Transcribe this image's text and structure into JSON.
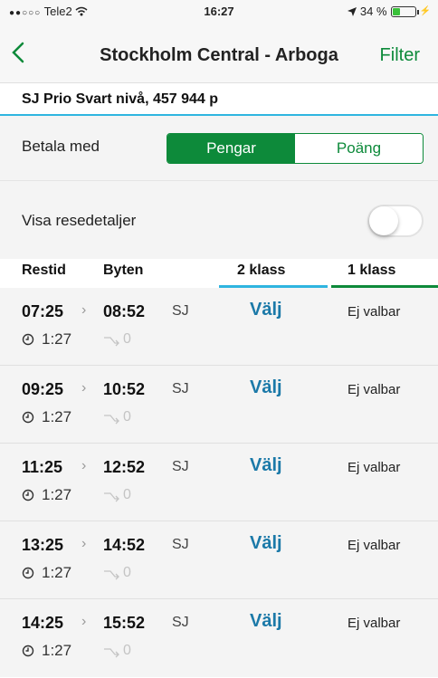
{
  "status": {
    "carrier": "Tele2",
    "time": "16:27",
    "battery_text": "34 %",
    "battery_level": 0.34
  },
  "nav": {
    "title": "Stockholm Central - Arboga",
    "filter_label": "Filter",
    "accent": "#0d8a3a"
  },
  "account": {
    "text": "SJ Prio Svart nivå, 457 944 p"
  },
  "payment": {
    "label": "Betala med",
    "options": [
      "Pengar",
      "Poäng"
    ],
    "selected": "Pengar"
  },
  "details": {
    "label": "Visa resedetaljer",
    "enabled": false
  },
  "columns": {
    "restid": "Restid",
    "byten": "Byten",
    "class2": "2 klass",
    "class1": "1 klass"
  },
  "journeys": [
    {
      "departure": "07:25",
      "arrival": "08:52",
      "operator": "SJ",
      "second_class": "Välj",
      "first_class": "Ej valbar",
      "duration": "1:27",
      "changes": "0"
    },
    {
      "departure": "09:25",
      "arrival": "10:52",
      "operator": "SJ",
      "second_class": "Välj",
      "first_class": "Ej valbar",
      "duration": "1:27",
      "changes": "0"
    },
    {
      "departure": "11:25",
      "arrival": "12:52",
      "operator": "SJ",
      "second_class": "Välj",
      "first_class": "Ej valbar",
      "duration": "1:27",
      "changes": "0"
    },
    {
      "departure": "13:25",
      "arrival": "14:52",
      "operator": "SJ",
      "second_class": "Välj",
      "first_class": "Ej valbar",
      "duration": "1:27",
      "changes": "0"
    },
    {
      "departure": "14:25",
      "arrival": "15:52",
      "operator": "SJ",
      "second_class": "Välj",
      "first_class": "Ej valbar",
      "duration": "1:27",
      "changes": "0"
    }
  ],
  "icons": {
    "back": "chevron-left-icon",
    "clock": "clock-icon",
    "changes": "transfer-icon",
    "wifi": "wifi-icon",
    "location": "location-arrow-icon",
    "battery": "battery-icon"
  }
}
